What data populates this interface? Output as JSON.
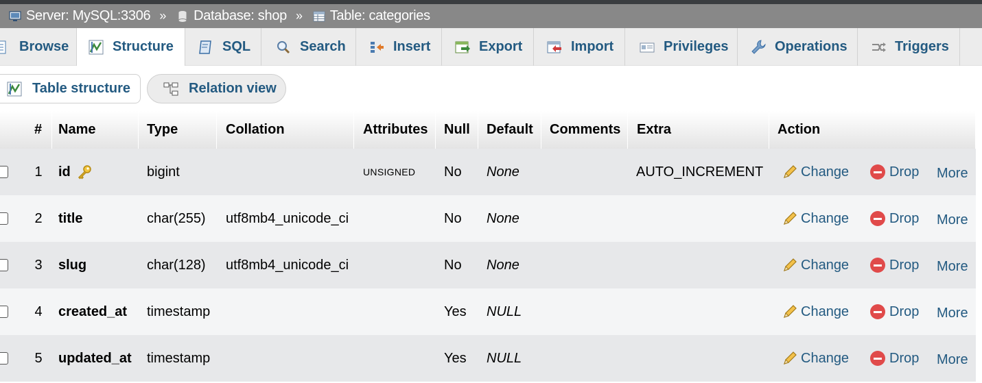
{
  "breadcrumb": {
    "server": "Server: MySQL:3306",
    "database": "Database: shop",
    "table": "Table: categories",
    "separator": "»"
  },
  "tabs": [
    {
      "label": "Browse",
      "icon": "browse-icon"
    },
    {
      "label": "Structure",
      "icon": "structure-icon",
      "active": true
    },
    {
      "label": "SQL",
      "icon": "sql-icon"
    },
    {
      "label": "Search",
      "icon": "search-icon"
    },
    {
      "label": "Insert",
      "icon": "insert-icon"
    },
    {
      "label": "Export",
      "icon": "export-icon"
    },
    {
      "label": "Import",
      "icon": "import-icon"
    },
    {
      "label": "Privileges",
      "icon": "privileges-icon"
    },
    {
      "label": "Operations",
      "icon": "wrench-icon"
    },
    {
      "label": "Triggers",
      "icon": "triggers-icon"
    }
  ],
  "subtabs": {
    "table_structure": "Table structure",
    "relation_view": "Relation view"
  },
  "table": {
    "headers": {
      "num": "#",
      "name": "Name",
      "type": "Type",
      "collation": "Collation",
      "attributes": "Attributes",
      "null": "Null",
      "default": "Default",
      "comments": "Comments",
      "extra": "Extra",
      "action": "Action"
    },
    "rows": [
      {
        "num": "1",
        "name": "id",
        "type": "bigint",
        "collation": "",
        "attributes": "UNSIGNED",
        "null": "No",
        "default": "None",
        "comments": "",
        "extra": "AUTO_INCREMENT",
        "primary_key": true
      },
      {
        "num": "2",
        "name": "title",
        "type": "char(255)",
        "collation": "utf8mb4_unicode_ci",
        "attributes": "",
        "null": "No",
        "default": "None",
        "comments": "",
        "extra": ""
      },
      {
        "num": "3",
        "name": "slug",
        "type": "char(128)",
        "collation": "utf8mb4_unicode_ci",
        "attributes": "",
        "null": "No",
        "default": "None",
        "comments": "",
        "extra": ""
      },
      {
        "num": "4",
        "name": "created_at",
        "type": "timestamp",
        "collation": "",
        "attributes": "",
        "null": "Yes",
        "default": "NULL",
        "comments": "",
        "extra": ""
      },
      {
        "num": "5",
        "name": "updated_at",
        "type": "timestamp",
        "collation": "",
        "attributes": "",
        "null": "Yes",
        "default": "NULL",
        "comments": "",
        "extra": ""
      }
    ],
    "actions": {
      "change": "Change",
      "drop": "Drop",
      "more": "More"
    }
  },
  "colors": {
    "link": "#235a81",
    "breadcrumb_bg": "#888888",
    "drop_red": "#e04a4a"
  }
}
